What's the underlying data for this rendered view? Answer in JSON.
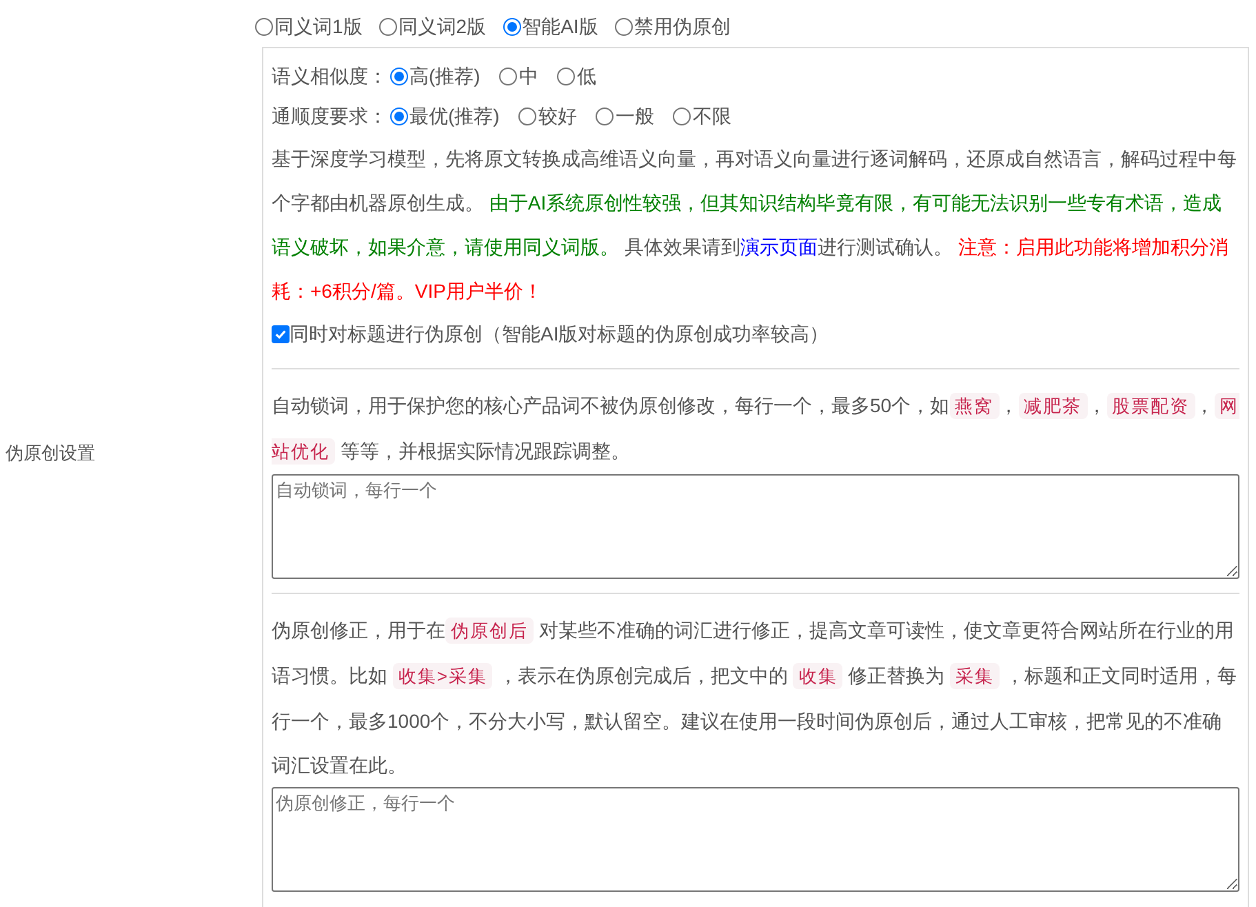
{
  "sidebar_label": "伪原创设置",
  "modes": [
    {
      "label": "同义词1版",
      "selected": false
    },
    {
      "label": "同义词2版",
      "selected": false
    },
    {
      "label": "智能AI版",
      "selected": true
    },
    {
      "label": "禁用伪原创",
      "selected": false
    }
  ],
  "options": [
    {
      "label": "语义相似度：",
      "choices": [
        {
          "label": "高(推荐)",
          "selected": true
        },
        {
          "label": "中",
          "selected": false
        },
        {
          "label": "低",
          "selected": false
        }
      ]
    },
    {
      "label": "通顺度要求：",
      "choices": [
        {
          "label": "最优(推荐)",
          "selected": true
        },
        {
          "label": "较好",
          "selected": false
        },
        {
          "label": "一般",
          "selected": false
        },
        {
          "label": "不限",
          "selected": false
        }
      ]
    }
  ],
  "description": [
    {
      "kind": "plain",
      "text": "基于深度学习模型，先将原文转换成高维语义向量，再对语义向量进行逐词解码，还原成自然语言，解码过程中每个字都由机器原创生成。 "
    },
    {
      "kind": "green",
      "text": "由于AI系统原创性较强，但其知识结构毕竟有限，有可能无法识别一些专有术语，造成语义破坏，如果介意，请使用同义词版。"
    },
    {
      "kind": "plain",
      "text": " 具体效果请到"
    },
    {
      "kind": "link",
      "text": "演示页面"
    },
    {
      "kind": "plain",
      "text": "进行测试确认。 "
    },
    {
      "kind": "red",
      "text": "注意：启用此功能将增加积分消耗：+6积分/篇。VIP用户半价！"
    }
  ],
  "title_checkbox": {
    "label": "同时对标题进行伪原创（智能AI版对标题的伪原创成功率较高）",
    "checked": true
  },
  "sections": [
    {
      "description": [
        {
          "kind": "plain",
          "text": "自动锁词，用于保护您的核心产品词不被伪原创修改，每行一个，最多50个，如"
        },
        {
          "kind": "code",
          "text": "燕窝"
        },
        {
          "kind": "plain",
          "text": "，"
        },
        {
          "kind": "code",
          "text": "减肥茶"
        },
        {
          "kind": "plain",
          "text": "，"
        },
        {
          "kind": "code",
          "text": "股票配资"
        },
        {
          "kind": "plain",
          "text": "，"
        },
        {
          "kind": "code",
          "text": "网站优化"
        },
        {
          "kind": "plain",
          "text": " 等等，并根据实际情况跟踪调整。"
        }
      ],
      "placeholder": "自动锁词，每行一个"
    },
    {
      "description": [
        {
          "kind": "plain",
          "text": "伪原创修正，用于在"
        },
        {
          "kind": "code",
          "text": "伪原创后"
        },
        {
          "kind": "plain",
          "text": " 对某些不准确的词汇进行修正，提高文章可读性，使文章更符合网站所在行业的用语习惯。比如 "
        },
        {
          "kind": "code",
          "text": "收集>采集"
        },
        {
          "kind": "plain",
          "text": " ，表示在伪原创完成后，把文中的 "
        },
        {
          "kind": "code",
          "text": "收集"
        },
        {
          "kind": "plain",
          "text": " 修正替换为 "
        },
        {
          "kind": "code",
          "text": "采集"
        },
        {
          "kind": "plain",
          "text": " ，标题和正文同时适用，每行一个，最多1000个，不分大小写，默认留空。建议在使用一段时间伪原创后，通过人工审核，把常见的不准确词汇设置在此。"
        }
      ],
      "placeholder": "伪原创修正，每行一个"
    }
  ]
}
